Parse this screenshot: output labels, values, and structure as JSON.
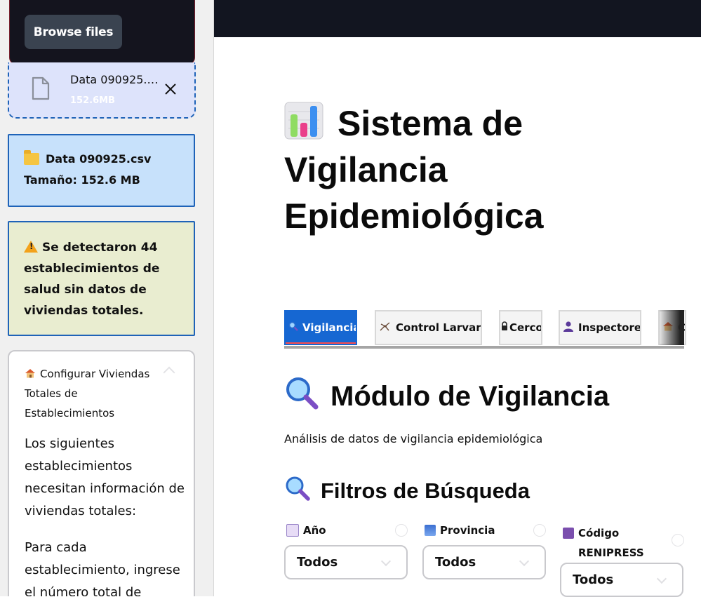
{
  "sidebar": {
    "upload": {
      "browse_label": "Browse files"
    },
    "file": {
      "name": "Data 090925.csv",
      "size": "152.6MB",
      "close_icon": "close-icon",
      "doc_icon": "file-icon"
    },
    "info": {
      "line1": "Data 090925.csv",
      "line2": "Tamaño: 152.6 MB",
      "icon": "folder-icon"
    },
    "warning": {
      "text": "Se detectaron 44 establecimientos de salud sin datos de viviendas totales.",
      "icon": "warning-icon"
    },
    "expander": {
      "title": "Configurar Viviendas Totales de Establecimientos",
      "icon": "house-icon",
      "paragraph1": "Los siguientes establecimientos necesitan información de viviendas totales:",
      "paragraph2": "Para cada establecimiento, ingrese el número total de"
    }
  },
  "main": {
    "title": "Sistema de Vigilancia Epidemiológica",
    "title_icon": "bar-chart-icon",
    "tabs": [
      {
        "label": "Vigilancia",
        "icon": "magnifier-icon",
        "active": true
      },
      {
        "label": "Control Larvario",
        "icon": "mosquito-icon",
        "active": false
      },
      {
        "label": "Cerco",
        "icon": "lock-icon",
        "active": false
      },
      {
        "label": "Inspectores",
        "icon": "person-icon",
        "active": false
      },
      {
        "label": "C",
        "icon": "house-icon",
        "active": false
      }
    ],
    "module_title": "Módulo de Vigilancia",
    "module_subtitle": "Análisis de datos de vigilancia epidemiológica",
    "filters_title": "Filtros de Búsqueda",
    "filters": [
      {
        "label": "Año",
        "icon": "calendar-icon",
        "value": "Todos"
      },
      {
        "label": "Provincia",
        "icon": "cityscape-icon",
        "value": "Todos"
      },
      {
        "label": "Código RENIPRESS",
        "icon": "floppy-disk-icon",
        "value": "Todos"
      }
    ]
  },
  "colors": {
    "accent_blue": "#1667d2",
    "active_tab_underline": "#ff4b4b",
    "info_bg": "#c7e1fb",
    "warning_bg": "#e9edd0",
    "topbar": "#121520"
  }
}
